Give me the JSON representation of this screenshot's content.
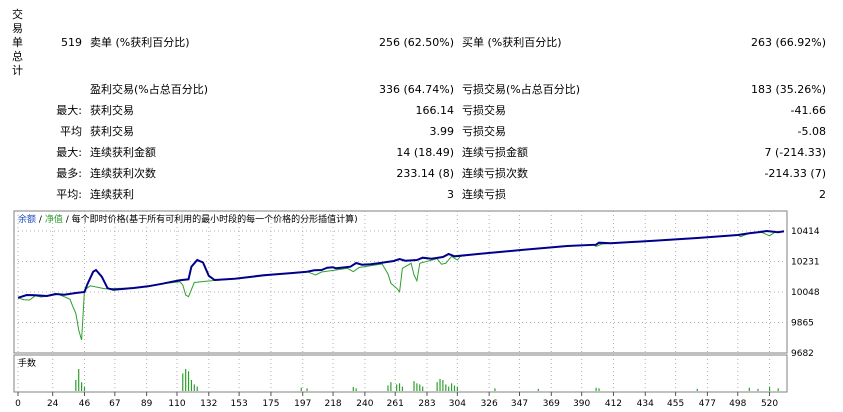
{
  "side_label": "交易单总计",
  "stats": {
    "total": "519",
    "short_label": "卖单 (%获利百分比)",
    "short_value": "256 (62.50%)",
    "long_label": "买单 (%获利百分比)",
    "long_value": "263 (66.92%)",
    "profit_label": "盈利交易(%占总百分比)",
    "profit_value": "336 (64.74%)",
    "loss_label": "亏损交易(%占总百分比)",
    "loss_value": "183 (35.26%)",
    "rows": [
      {
        "prefix": "最大:",
        "left_label": "获利交易",
        "left_value": "166.14",
        "right_label": "亏损交易",
        "right_value": "-41.66"
      },
      {
        "prefix": "平均",
        "left_label": "获利交易",
        "left_value": "3.99",
        "right_label": "亏损交易",
        "right_value": "-5.08"
      },
      {
        "prefix": "最大:",
        "left_label": "连续获利金额",
        "left_value": "14 (18.49)",
        "right_label": "连续亏损金额",
        "right_value": "7 (-214.33)"
      },
      {
        "prefix": "最多:",
        "left_label": "连续获利次数",
        "left_value": "233.14 (8)",
        "right_label": "连续亏损次数",
        "right_value": "-214.33 (7)"
      },
      {
        "prefix": "平均:",
        "left_label": "连续获利",
        "left_value": "3",
        "right_label": "连续亏损",
        "right_value": "2"
      }
    ]
  },
  "chart_header": {
    "balance": "余额",
    "sep1": "/",
    "equity": "净值",
    "sep2": "/",
    "description": "每个即时价格(基于所有可利用的最小时段的每一个价格的分形插值计算)"
  },
  "volume_label": "手数",
  "colors": {
    "balance_line": "#00008b",
    "equity_line": "#2ca02c",
    "volume_bars": "#2ca02c",
    "header_blue": "#1f4fbf",
    "header_green": "#2ca02c",
    "grid": "#b0b0b0"
  },
  "chart_data": {
    "type": "line",
    "x_ticks": [
      "0",
      "24",
      "46",
      "67",
      "89",
      "110",
      "132",
      "153",
      "175",
      "197",
      "218",
      "240",
      "261",
      "283",
      "304",
      "326",
      "347",
      "369",
      "390",
      "412",
      "434",
      "455",
      "477",
      "498",
      "520"
    ],
    "y_ticks": [
      "10414",
      "10231",
      "10048",
      "9865",
      "9682"
    ],
    "ylim": [
      9682,
      10450
    ],
    "xlim": [
      0,
      530
    ],
    "series": [
      {
        "name": "余额",
        "points": [
          [
            0,
            10013
          ],
          [
            6,
            10030
          ],
          [
            12,
            10028
          ],
          [
            20,
            10024
          ],
          [
            26,
            10036
          ],
          [
            32,
            10032
          ],
          [
            40,
            10042
          ],
          [
            46,
            10048
          ],
          [
            48,
            10095
          ],
          [
            52,
            10170
          ],
          [
            54,
            10180
          ],
          [
            58,
            10140
          ],
          [
            62,
            10070
          ],
          [
            66,
            10062
          ],
          [
            80,
            10072
          ],
          [
            90,
            10082
          ],
          [
            100,
            10098
          ],
          [
            108,
            10112
          ],
          [
            112,
            10118
          ],
          [
            118,
            10124
          ],
          [
            120,
            10200
          ],
          [
            124,
            10240
          ],
          [
            128,
            10225
          ],
          [
            132,
            10145
          ],
          [
            136,
            10120
          ],
          [
            150,
            10128
          ],
          [
            170,
            10148
          ],
          [
            190,
            10162
          ],
          [
            200,
            10170
          ],
          [
            205,
            10178
          ],
          [
            210,
            10180
          ],
          [
            214,
            10194
          ],
          [
            218,
            10196
          ],
          [
            220,
            10190
          ],
          [
            230,
            10200
          ],
          [
            234,
            10222
          ],
          [
            238,
            10212
          ],
          [
            244,
            10214
          ],
          [
            254,
            10226
          ],
          [
            260,
            10234
          ],
          [
            264,
            10246
          ],
          [
            268,
            10236
          ],
          [
            276,
            10240
          ],
          [
            280,
            10254
          ],
          [
            286,
            10247
          ],
          [
            294,
            10258
          ],
          [
            298,
            10276
          ],
          [
            302,
            10262
          ],
          [
            320,
            10277
          ],
          [
            350,
            10302
          ],
          [
            380,
            10324
          ],
          [
            400,
            10332
          ],
          [
            402,
            10344
          ],
          [
            410,
            10340
          ],
          [
            440,
            10356
          ],
          [
            470,
            10372
          ],
          [
            498,
            10390
          ],
          [
            506,
            10400
          ],
          [
            512,
            10406
          ],
          [
            518,
            10414
          ],
          [
            526,
            10407
          ],
          [
            530,
            10412
          ]
        ]
      },
      {
        "name": "净值",
        "points": [
          [
            0,
            10013
          ],
          [
            4,
            10002
          ],
          [
            8,
            10000
          ],
          [
            12,
            10026
          ],
          [
            16,
            10018
          ],
          [
            22,
            10026
          ],
          [
            28,
            10034
          ],
          [
            32,
            10020
          ],
          [
            36,
            10004
          ],
          [
            38,
            9960
          ],
          [
            40,
            9920
          ],
          [
            42,
            9820
          ],
          [
            44,
            9760
          ],
          [
            46,
            10060
          ],
          [
            50,
            10085
          ],
          [
            60,
            10068
          ],
          [
            80,
            10072
          ],
          [
            100,
            10098
          ],
          [
            112,
            10110
          ],
          [
            114,
            10090
          ],
          [
            116,
            10030
          ],
          [
            118,
            10020
          ],
          [
            122,
            10105
          ],
          [
            130,
            10112
          ],
          [
            150,
            10128
          ],
          [
            190,
            10162
          ],
          [
            200,
            10170
          ],
          [
            206,
            10150
          ],
          [
            210,
            10168
          ],
          [
            220,
            10180
          ],
          [
            228,
            10190
          ],
          [
            232,
            10170
          ],
          [
            236,
            10195
          ],
          [
            252,
            10216
          ],
          [
            256,
            10156
          ],
          [
            258,
            10100
          ],
          [
            262,
            10070
          ],
          [
            264,
            10050
          ],
          [
            266,
            10190
          ],
          [
            272,
            10220
          ],
          [
            274,
            10150
          ],
          [
            276,
            10115
          ],
          [
            278,
            10220
          ],
          [
            290,
            10248
          ],
          [
            293,
            10215
          ],
          [
            296,
            10220
          ],
          [
            300,
            10262
          ],
          [
            302,
            10250
          ],
          [
            304,
            10240
          ],
          [
            306,
            10262
          ],
          [
            320,
            10277
          ],
          [
            350,
            10302
          ],
          [
            380,
            10324
          ],
          [
            398,
            10330
          ],
          [
            400,
            10322
          ],
          [
            404,
            10336
          ],
          [
            440,
            10356
          ],
          [
            498,
            10390
          ],
          [
            500,
            10380
          ],
          [
            506,
            10400
          ],
          [
            514,
            10408
          ],
          [
            520,
            10385
          ],
          [
            524,
            10408
          ],
          [
            530,
            10410
          ]
        ]
      }
    ],
    "volume": [
      [
        40,
        0.5
      ],
      [
        42,
        1.0
      ],
      [
        44,
        0.4
      ],
      [
        46,
        0.2
      ],
      [
        114,
        0.8
      ],
      [
        116,
        1.0
      ],
      [
        118,
        0.9
      ],
      [
        120,
        0.5
      ],
      [
        122,
        0.3
      ],
      [
        124,
        0.2
      ],
      [
        196,
        0.15
      ],
      [
        200,
        0.12
      ],
      [
        232,
        0.18
      ],
      [
        234,
        0.12
      ],
      [
        256,
        0.25
      ],
      [
        258,
        0.4
      ],
      [
        262,
        0.3
      ],
      [
        264,
        0.35
      ],
      [
        266,
        0.2
      ],
      [
        274,
        0.45
      ],
      [
        276,
        0.35
      ],
      [
        278,
        0.3
      ],
      [
        280,
        0.2
      ],
      [
        290,
        0.4
      ],
      [
        292,
        0.55
      ],
      [
        294,
        0.5
      ],
      [
        296,
        0.3
      ],
      [
        298,
        0.2
      ],
      [
        300,
        0.35
      ],
      [
        302,
        0.25
      ],
      [
        304,
        0.2
      ],
      [
        330,
        0.12
      ],
      [
        360,
        0.1
      ],
      [
        400,
        0.15
      ],
      [
        402,
        0.12
      ],
      [
        470,
        0.1
      ],
      [
        506,
        0.15
      ],
      [
        512,
        0.1
      ],
      [
        520,
        0.2
      ],
      [
        526,
        0.12
      ]
    ]
  }
}
